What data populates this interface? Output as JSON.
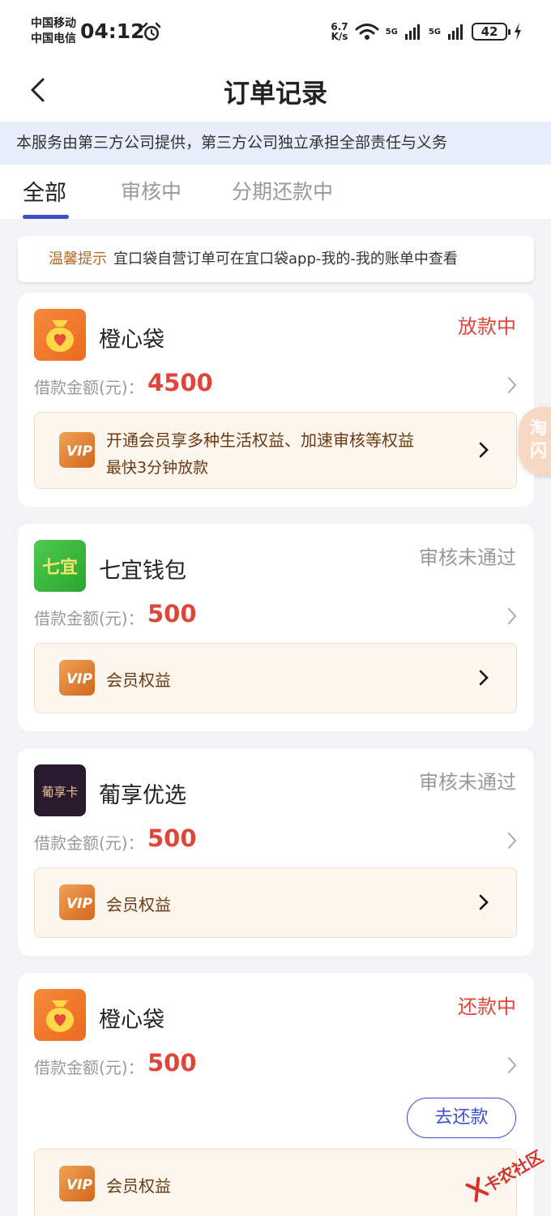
{
  "status_bar": {
    "carrier1": "中国移动",
    "carrier2": "中国电信",
    "time": "04:12",
    "speed_value": "6.7",
    "speed_unit": "K/s",
    "net1": "5G",
    "net2": "5G",
    "battery": "42"
  },
  "header": {
    "title": "订单记录"
  },
  "notice": {
    "text": "本服务由第三方公司提供，第三方公司独立承担全部责任与义务"
  },
  "tabs": [
    {
      "label": "全部",
      "active": true
    },
    {
      "label": "审核中",
      "active": false
    },
    {
      "label": "分期还款中",
      "active": false
    }
  ],
  "tip": {
    "label": "温馨提示",
    "text": "宜口袋自营订单可在宜口袋app-我的-我的账单中查看"
  },
  "amount_label": "借款金额(元)：",
  "orders": [
    {
      "name": "橙心袋",
      "status": "放款中",
      "amount": "4500",
      "vip_title": "开通会员享多种生活权益、加速审核等权益",
      "vip_sub": "最快3分钟放款"
    },
    {
      "name": "七宜钱包",
      "logo_text": "七宜",
      "status": "审核未通过",
      "amount": "500",
      "vip_title": "会员权益"
    },
    {
      "name": "葡享优选",
      "logo_text": "葡享卡",
      "status": "审核未通过",
      "amount": "500",
      "vip_title": "会员权益"
    },
    {
      "name": "橙心袋",
      "status": "还款中",
      "amount": "500",
      "repay_button": "去还款",
      "vip_title": "会员权益"
    }
  ],
  "float_badge": {
    "line1": "淘",
    "line2": "闪"
  },
  "watermark": {
    "text": "卡农社区"
  },
  "colors": {
    "accent": "#3d4fc9",
    "status_red": "#e0453a",
    "status_gray": "#999999",
    "vip_text": "#6b3a12"
  }
}
